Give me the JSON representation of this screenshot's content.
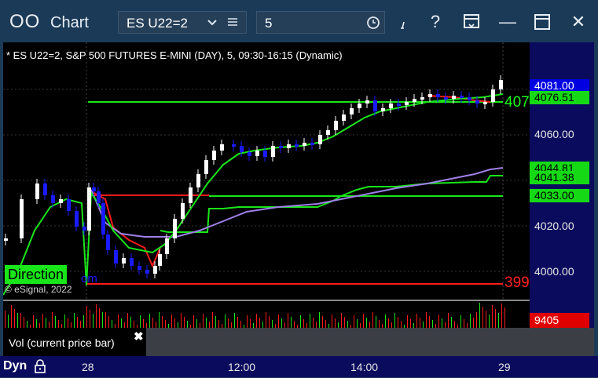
{
  "window": {
    "app_icon": "OO",
    "title": "Chart",
    "symbol_value": "ES U22=2",
    "interval_value": "5",
    "controls": {
      "help": "?",
      "minimize": "—",
      "close": "✕"
    }
  },
  "chart": {
    "header": "* ES U22=2, S&P 500 FUTURES E-MINI (DAY), 5, 09:30-16:15 (Dynamic)",
    "copyright": "© eSignal, 2022",
    "direction_label": "Direction",
    "direction_tail": "om",
    "right_value_green": "407",
    "right_value_red": "399"
  },
  "price_axis": {
    "labels": [
      "4060.00",
      "4020.00",
      "4000.00"
    ],
    "tags": [
      {
        "text": "4081.00",
        "bg": "#0000e0",
        "fg": "#ffffff"
      },
      {
        "text": "4076.51",
        "bg": "#16d916",
        "fg": "#000000"
      },
      {
        "text": "4044.81",
        "bg": "#16d916",
        "fg": "#000000"
      },
      {
        "text": "4041.38",
        "bg": "#16d916",
        "fg": "#000000"
      },
      {
        "text": "4033.00",
        "bg": "#16d916",
        "fg": "#000000"
      }
    ]
  },
  "volume": {
    "value": "9405",
    "legend": "Vol (current price bar)",
    "close_icon": "✖"
  },
  "time_axis": {
    "left_label": "Dyn",
    "labels": [
      "28",
      "12:00",
      "14:00",
      "29"
    ]
  },
  "colors": {
    "up_candle": "#ffffff",
    "down_candle": "#1a1aff",
    "green_line": "#19e619",
    "red_line": "#ff1a1a",
    "purple_line": "#a080e8",
    "axis_bg": "#0b0b5e",
    "titlebar_bg": "#1b3a57"
  }
}
